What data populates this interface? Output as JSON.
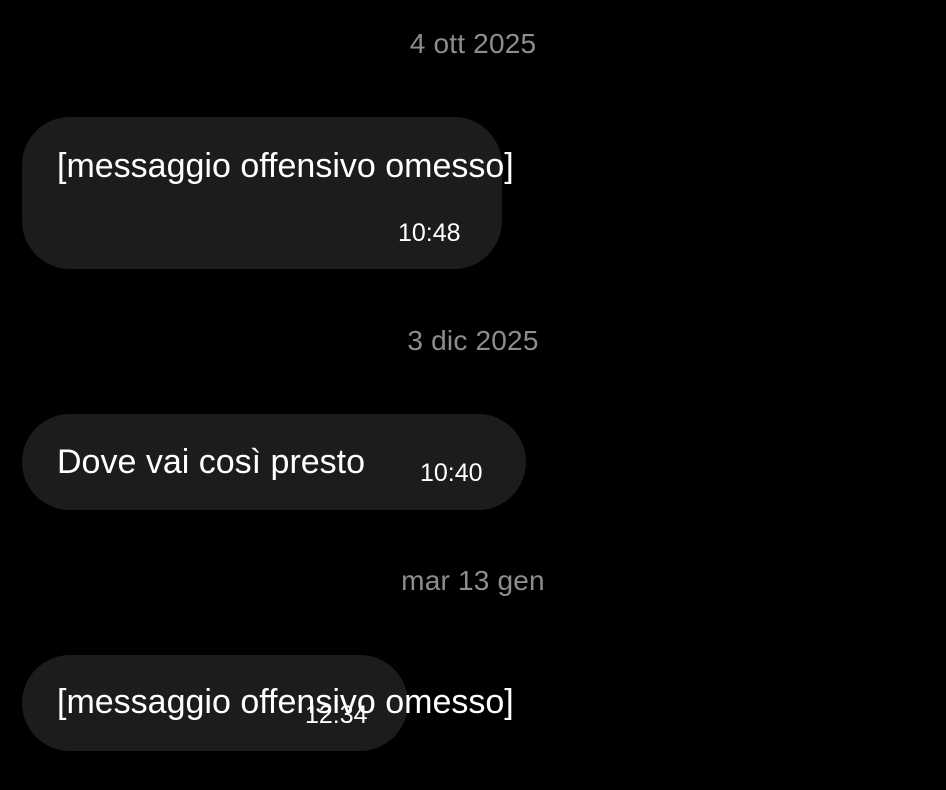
{
  "conversation": {
    "colors": {
      "background": "#000000",
      "bubble": "#1c1c1e",
      "date_text": "#8b8d91",
      "message_text": "#ffffff"
    },
    "items": [
      {
        "date": "4 ott 2025",
        "message": "[messaggio offensivo omesso]",
        "time": "10:48"
      },
      {
        "date": "3 dic 2025",
        "message": "Dove vai così presto",
        "time": "10:40"
      },
      {
        "date": "mar 13 gen",
        "message": "[messaggio offensivo omesso]",
        "time": "12:34"
      }
    ]
  }
}
